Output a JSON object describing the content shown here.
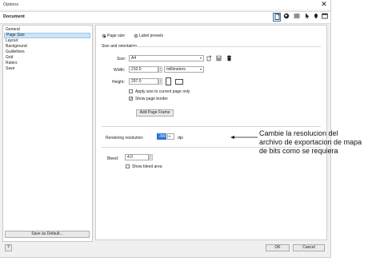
{
  "window": {
    "title": "Options",
    "close_glyph": "✕"
  },
  "header": {
    "section_title": "Document"
  },
  "toolbar_icons": [
    "page-icon",
    "globe-icon",
    "list-icon",
    "pointer-icon",
    "shape-icon",
    "window-icon"
  ],
  "sidebar": {
    "items": [
      {
        "label": "General"
      },
      {
        "label": "Page Size"
      },
      {
        "label": "Layout"
      },
      {
        "label": "Background"
      },
      {
        "label": "Guidelines"
      },
      {
        "label": "Grid"
      },
      {
        "label": "Rulers"
      },
      {
        "label": "Save"
      }
    ],
    "selected": "Page Size",
    "save_default_label": "Save as Default..."
  },
  "page_size": {
    "radio_page_size": "Page size",
    "radio_label_presets": "Label presets",
    "selected_radio": "Page size",
    "size_orientation_header": "Size and orientation",
    "size_label": "Size:",
    "size_value": "A4",
    "width_label": "Width:",
    "width_value": "210.0",
    "units_value": "millimeters",
    "height_label": "Height:",
    "height_value": "297.0",
    "apply_current_page_label": "Apply size to current page only",
    "apply_current_page_checked": false,
    "show_border_label": "Show page border",
    "show_border_checked": true,
    "add_frame_label": "Add Page Frame"
  },
  "rendering": {
    "label": "Rendering resolution:",
    "value": "300",
    "unit": "dpi"
  },
  "bleed": {
    "label": "Bleed:",
    "value": "4.0",
    "show_area_label": "Show bleed area",
    "show_area_checked": false
  },
  "footer": {
    "help_label": "?",
    "ok_label": "OK",
    "cancel_label": "Cancel"
  },
  "annotation": {
    "line1": "Cambie la resolucion del",
    "line2": "archivo de exportacion de mapa",
    "line3": "de bits como se requiera"
  }
}
